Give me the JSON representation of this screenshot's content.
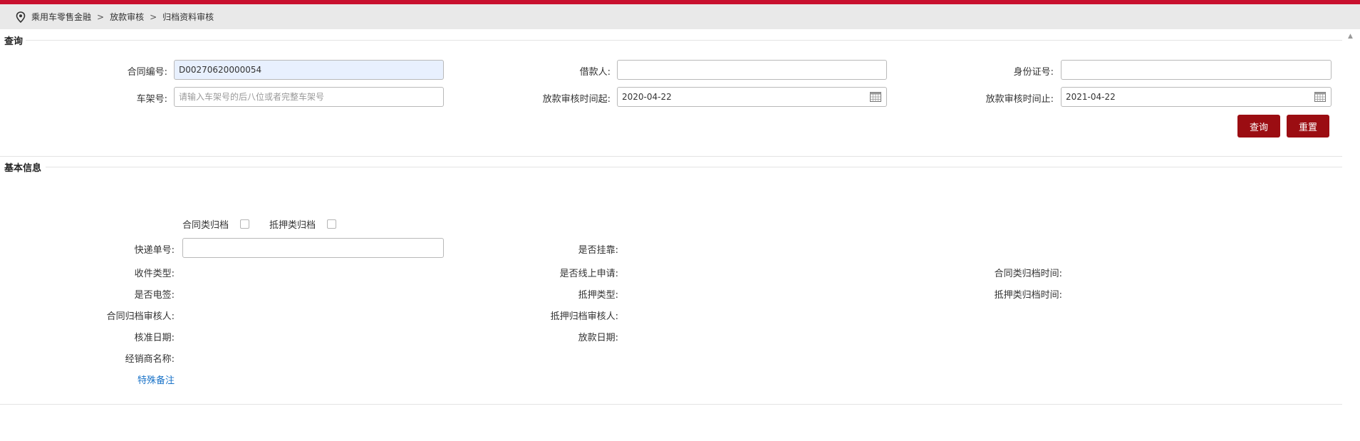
{
  "breadcrumb": {
    "items": [
      "乘用车零售金融",
      "放款审核",
      "归档资料审核"
    ],
    "separator": ">"
  },
  "query": {
    "title": "查询",
    "contract_no": {
      "label": "合同编号:",
      "value": "D00270620000054"
    },
    "borrower": {
      "label": "借款人:",
      "value": ""
    },
    "id_no": {
      "label": "身份证号:",
      "value": ""
    },
    "vin": {
      "label": "车架号:",
      "placeholder": "请输入车架号的后八位或者完整车架号"
    },
    "audit_from": {
      "label": "放款审核时间起:",
      "value": "2020-04-22"
    },
    "audit_to": {
      "label": "放款审核时间止:",
      "value": "2021-04-22"
    },
    "search_label": "查询",
    "reset_label": "重置"
  },
  "basic": {
    "title": "基本信息",
    "contract_archive": "合同类归档",
    "mortgage_archive": "抵押类归档",
    "express_no": "快递单号:",
    "is_affiliated": "是否挂靠:",
    "receive_type": "收件类型:",
    "is_online": "是否线上申请:",
    "contract_archive_time": "合同类归档时间:",
    "is_esign": "是否电签:",
    "mortgage_type": "抵押类型:",
    "mortgage_archive_time": "抵押类归档时间:",
    "contract_reviewer": "合同归档审核人:",
    "mortgage_reviewer": "抵押归档审核人:",
    "approve_date": "核准日期:",
    "loan_date": "放款日期:",
    "dealer_name": "经销商名称:",
    "special_note": "特殊备注"
  },
  "colors": {
    "accent": "#9b0d12",
    "top_bar": "#c8102e",
    "link": "#1a73c8"
  }
}
